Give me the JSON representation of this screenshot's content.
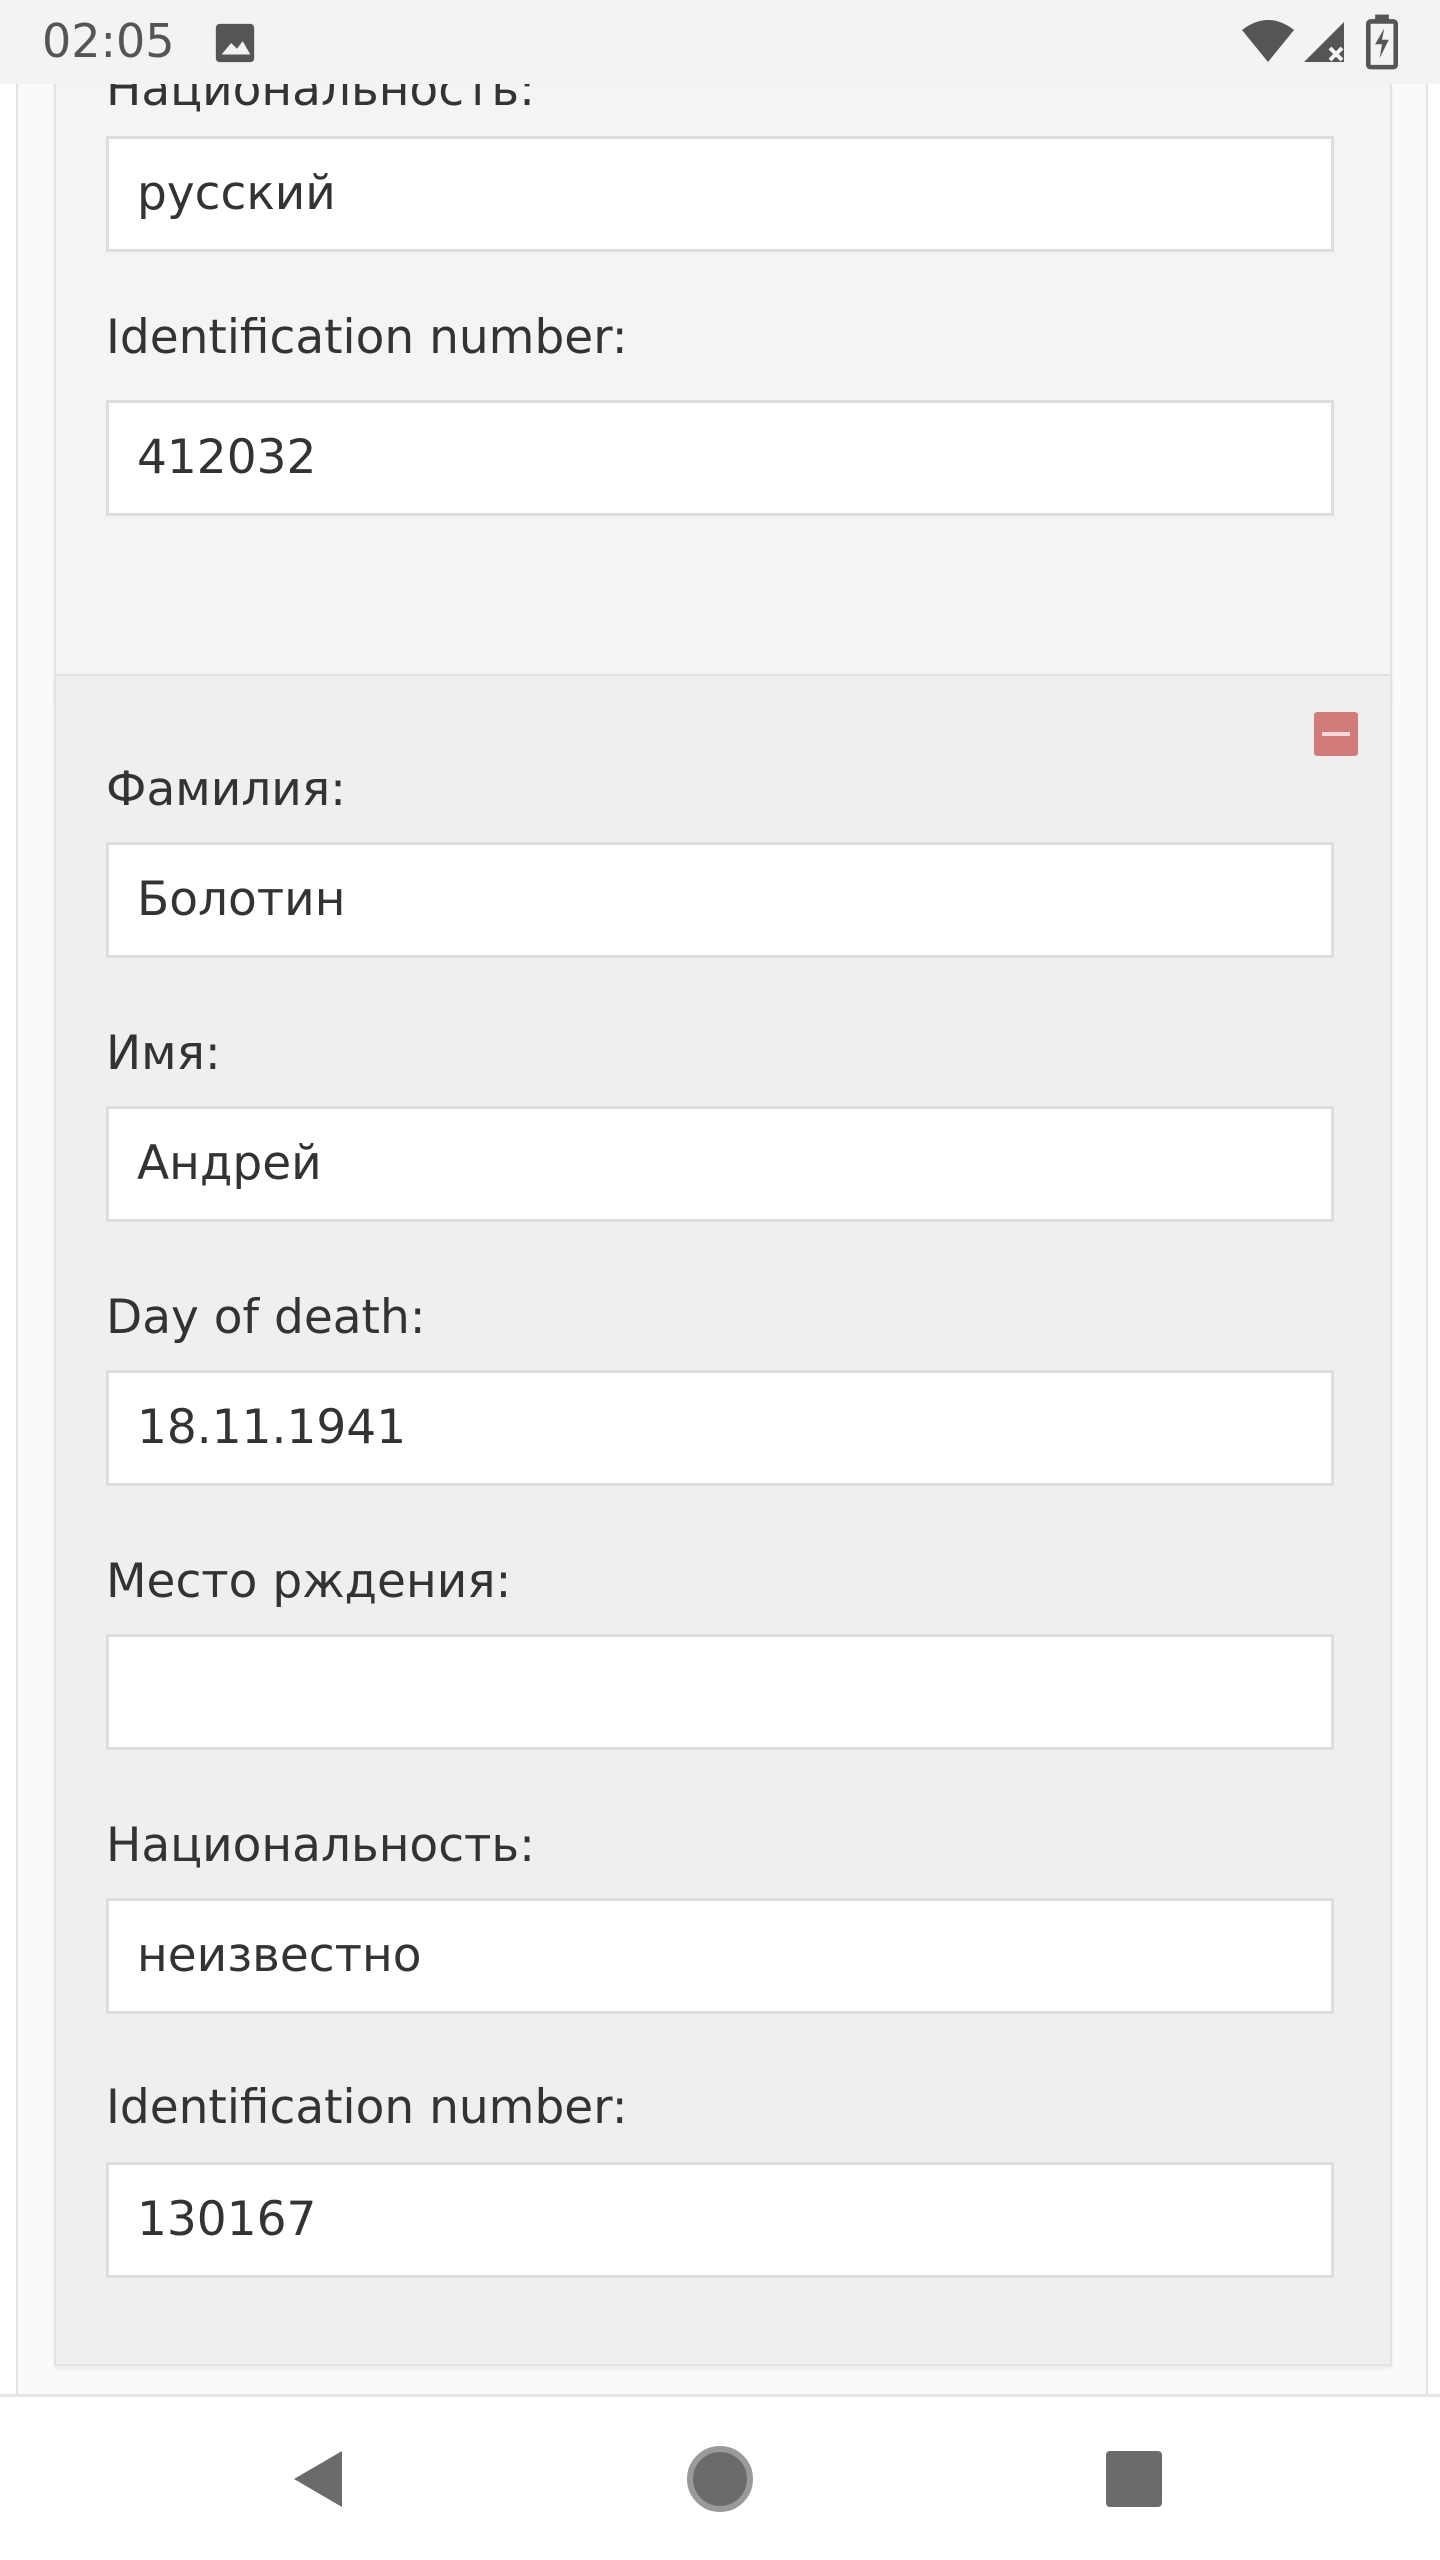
{
  "status_bar": {
    "time": "02:05",
    "icons": [
      "image-icon",
      "wifi-icon",
      "signal-icon",
      "battery-charging-icon"
    ]
  },
  "records": [
    {
      "fields": [
        {
          "label": "Национальность:",
          "value": "русский"
        },
        {
          "label": "Identification number:",
          "value": "412032"
        }
      ]
    },
    {
      "remove_icon": "minus-icon",
      "fields": [
        {
          "label": "Фамилия:",
          "value": "Болотин"
        },
        {
          "label": "Имя:",
          "value": "Андрей"
        },
        {
          "label": "Day of death:",
          "value": "18.11.1941"
        },
        {
          "label": "Место рждения:",
          "value": ""
        },
        {
          "label": "Национальность:",
          "value": "неизвестно"
        },
        {
          "label": "Identification number:",
          "value": "130167"
        }
      ]
    }
  ],
  "colors": {
    "card_bg": "#efefef",
    "remove_button": "#d27b7b"
  },
  "nav_bar": {
    "icons": [
      "back-icon",
      "home-icon",
      "recents-icon"
    ]
  }
}
